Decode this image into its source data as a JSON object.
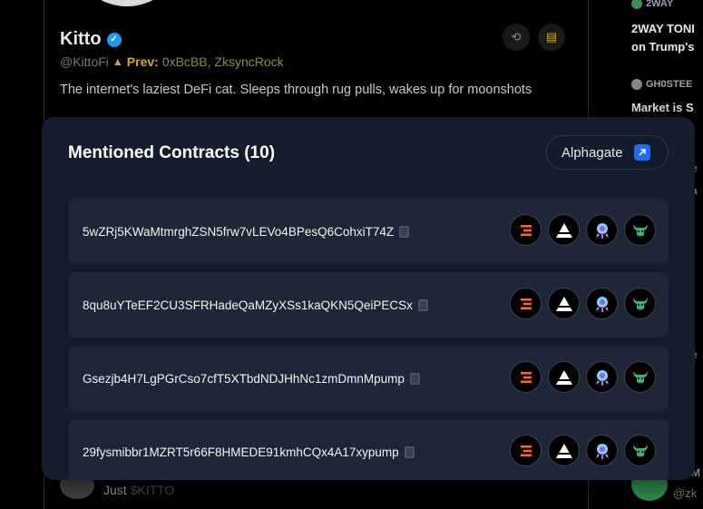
{
  "profile": {
    "name": "Kitto",
    "handle": "@KittoFi",
    "prev_label": "Prev:",
    "prev_names": "0xBcBB, ZksyncRock",
    "bio": "The internet's laziest DeFi cat. Sleeps through rug pulls, wakes up for moonshots"
  },
  "feed": {
    "bottom_text_prefix": "Just",
    "bottom_cashtag": "$KITTO"
  },
  "sidebar": {
    "item1_author": "2WAY",
    "item1_title": "2WAY TONI",
    "item1_sub": "on Trump's",
    "item2_author": "GH0STEE",
    "item2_title": "Market is S",
    "bottom_handle": "@zk",
    "frag_a": "e",
    "frag_b": "a",
    "frag_c": "'",
    "frag_d": "e",
    "frag_e": "M"
  },
  "modal": {
    "title": "Mentioned Contracts (10)",
    "alphagate_label": "Alphagate",
    "contracts": [
      {
        "address": "5wZRj5KWaMtmrghZSN5frw7vLEVo4BPesQ6CohxiT74Z"
      },
      {
        "address": "8qu8uYTeEF2CU3SFRHadeQaMZyXSs1kaQKN5QeiPECSx"
      },
      {
        "address": "Gsezjb4H7LgPGrCso7cfT5XTbdNDJHhNc1zmDmnMpump"
      },
      {
        "address": "29fysmibbr1MZRT5r66F8HMEDE91kmhCQx4A17xypump"
      }
    ],
    "tool_icons": [
      "orange-bars-icon",
      "triangle-icon",
      "rocket-icon",
      "bull-icon"
    ]
  },
  "colors": {
    "modal_bg": "#151c2c",
    "row_bg": "#1e2637",
    "accent_blue": "#1d6ef5",
    "verified_blue": "#1d9bf0",
    "warning_gold": "#d4a72c"
  }
}
